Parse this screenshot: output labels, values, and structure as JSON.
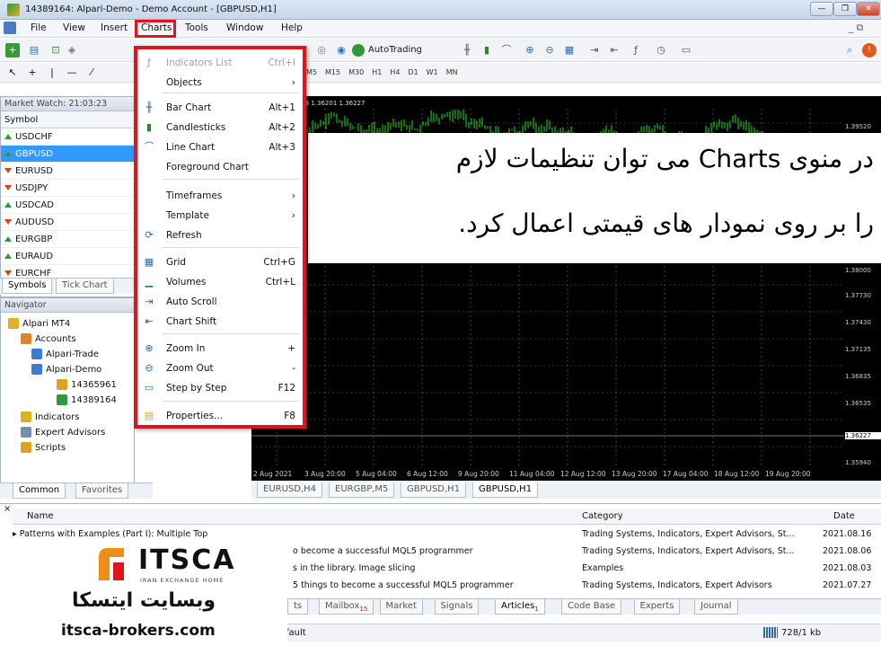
{
  "window": {
    "title": "14389164: Alpari-Demo - Demo Account - [GBPUSD,H1]"
  },
  "menubar": {
    "items": [
      "File",
      "View",
      "Insert",
      "Charts",
      "Tools",
      "Window",
      "Help"
    ]
  },
  "toolbar": {
    "autotrading_label": "AutoTrading",
    "timeframes": [
      "M5",
      "M15",
      "M30",
      "H1",
      "H4",
      "D1",
      "W1",
      "MN"
    ]
  },
  "market_watch": {
    "header": "Market Watch: 21:03:23",
    "column": "Symbol",
    "rows": [
      {
        "symbol": "USDCHF",
        "dir": "up"
      },
      {
        "symbol": "GBPUSD",
        "dir": "up",
        "selected": true
      },
      {
        "symbol": "EURUSD",
        "dir": "down"
      },
      {
        "symbol": "USDJPY",
        "dir": "down"
      },
      {
        "symbol": "USDCAD",
        "dir": "up"
      },
      {
        "symbol": "AUDUSD",
        "dir": "down"
      },
      {
        "symbol": "EURGBP",
        "dir": "up"
      },
      {
        "symbol": "EURAUD",
        "dir": "up"
      },
      {
        "symbol": "EURCHF",
        "dir": "down"
      }
    ],
    "tabs": [
      "Symbols",
      "Tick Chart"
    ]
  },
  "navigator": {
    "header": "Navigator",
    "root": "Alpari MT4",
    "accounts": "Accounts",
    "trade_server": "Alpari-Trade",
    "demo_server": "Alpari-Demo",
    "account1": "14365961",
    "account2": "14389164",
    "indicators": "Indicators",
    "experts": "Expert Advisors",
    "scripts": "Scripts",
    "tabs": [
      "Common",
      "Favorites"
    ]
  },
  "charts_menu": {
    "items": [
      {
        "label": "Indicators List",
        "shortcut": "Ctrl+I",
        "disabled": true
      },
      {
        "label": "Objects",
        "submenu": true
      },
      {
        "label": "Bar Chart",
        "shortcut": "Alt+1"
      },
      {
        "label": "Candlesticks",
        "shortcut": "Alt+2"
      },
      {
        "label": "Line Chart",
        "shortcut": "Alt+3"
      },
      {
        "label": "Foreground Chart"
      },
      {
        "label": "Timeframes",
        "submenu": true
      },
      {
        "label": "Template",
        "submenu": true
      },
      {
        "label": "Refresh"
      },
      {
        "label": "Grid",
        "shortcut": "Ctrl+G"
      },
      {
        "label": "Volumes",
        "shortcut": "Ctrl+L"
      },
      {
        "label": "Auto Scroll"
      },
      {
        "label": "Chart Shift"
      },
      {
        "label": "Zoom In",
        "shortcut": "+"
      },
      {
        "label": "Zoom Out",
        "shortcut": "-"
      },
      {
        "label": "Step by Step",
        "shortcut": "F12"
      },
      {
        "label": "Properties...",
        "shortcut": "F8"
      }
    ]
  },
  "chart": {
    "ohlc": "1.36201 1.36228 1.36201 1.36227",
    "price_labels": [
      "1.39520",
      "1.38000",
      "1.37730",
      "1.37430",
      "1.37135",
      "1.36835",
      "1.36535",
      "1.36227",
      "1.35940"
    ],
    "dates": [
      "2 Aug 2021",
      "3 Aug 20:00",
      "5 Aug 04:00",
      "6 Aug 12:00",
      "9 Aug 20:00",
      "11 Aug 04:00",
      "12 Aug 12:00",
      "13 Aug 20:00",
      "17 Aug 04:00",
      "18 Aug 12:00",
      "19 Aug 20:00"
    ],
    "tabs": [
      "EURUSD,H4",
      "EURGBP,M5",
      "GBPUSD,H1",
      "GBPUSD,H1"
    ]
  },
  "banner": {
    "line1": "در منوی Charts می توان تنظیمات لازم",
    "line2": "را بر روی نمودار های قیمتی اعمال کرد."
  },
  "terminal": {
    "col_name": "Name",
    "col_category": "Category",
    "col_date": "Date",
    "rows": [
      {
        "name": "Patterns with Examples (Part I): Multiple Top",
        "category": "Trading Systems, Indicators, Expert Advisors, St...",
        "date": "2021.08.16"
      },
      {
        "name": "o become a successful MQL5 programmer",
        "category": "Trading Systems, Indicators, Expert Advisors, St...",
        "date": "2021.08.06"
      },
      {
        "name": "s in the library. Image slicing",
        "category": "Examples",
        "date": "2021.08.03"
      },
      {
        "name": "5 things to become a successful MQL5 programmer",
        "category": "Trading Systems, Indicators, Expert Advisors",
        "date": "2021.07.27"
      }
    ],
    "tabs": [
      "ts",
      "Mailbox",
      "Market",
      "Signals",
      "Articles",
      "Code Base",
      "Experts",
      "Journal"
    ],
    "mailbox_badge": "15",
    "articles_badge": "1",
    "status_left": "fault",
    "status_right": "728/1 kb"
  },
  "logo": {
    "brand": "ITSCA",
    "tagline": "IRAN EXCHANGE HOME",
    "fa_name": "وبسایت ایتسکا",
    "url": "itsca-brokers.com"
  },
  "colors": {
    "highlight": "#e0141b",
    "select": "#3399ff",
    "bull": "#22dd22",
    "chart_bg": "#000000"
  }
}
